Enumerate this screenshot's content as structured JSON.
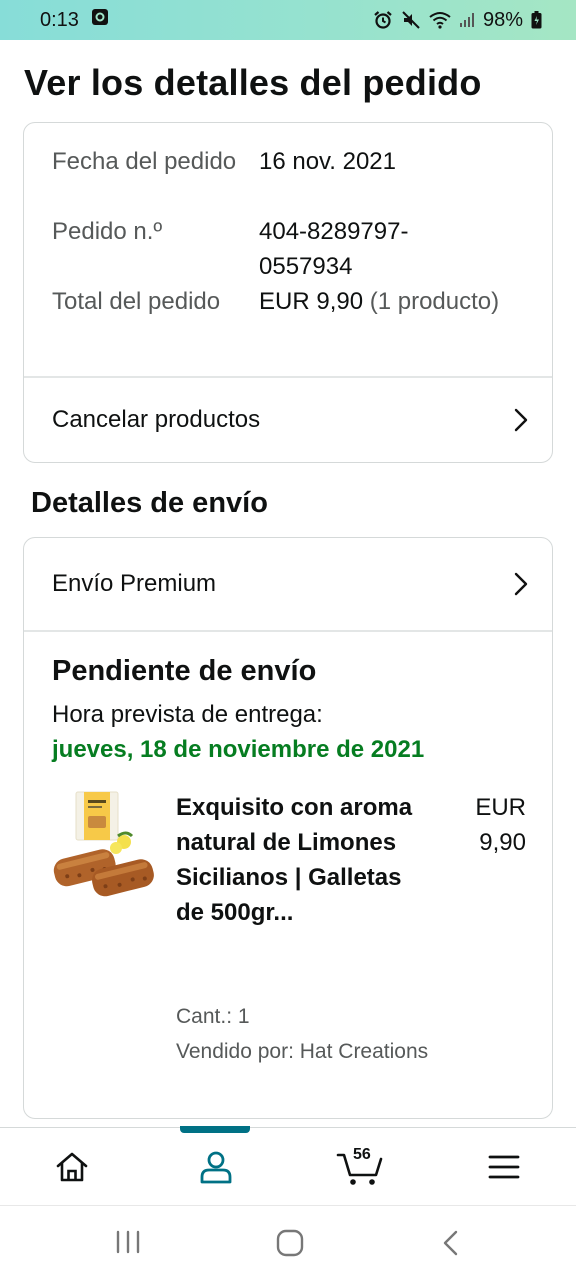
{
  "status_bar": {
    "time": "0:13",
    "battery": "98%"
  },
  "page": {
    "title": "Ver los detalles del pedido"
  },
  "order": {
    "date_label": "Fecha del pedido",
    "date_value": "16 nov. 2021",
    "number_label": "Pedido n.º",
    "number_value": "404-8289797-0557934",
    "total_label": "Total del pedido",
    "total_value": "EUR 9,90",
    "total_count": "(1 producto)",
    "cancel_label": "Cancelar productos"
  },
  "shipping": {
    "heading": "Detalles de envío",
    "method_label": "Envío Premium",
    "status_title": "Pendiente de envío",
    "delivery_label": "Hora prevista de entrega:",
    "delivery_date": "jueves, 18 de noviembre de 2021",
    "accent_color": "#067d21"
  },
  "product": {
    "name": "Exquisito con aroma natural de Limones Sicilianos | Galletas de 500gr...",
    "price": "EUR 9,90",
    "quantity": "Cant.: 1",
    "seller": "Vendido por: Hat Creations"
  },
  "bottom_nav": {
    "items": [
      {
        "icon": "home-icon"
      },
      {
        "icon": "account-icon",
        "active": true
      },
      {
        "icon": "cart-icon",
        "badge": "56"
      },
      {
        "icon": "menu-icon"
      }
    ],
    "active_color": "#007185"
  }
}
